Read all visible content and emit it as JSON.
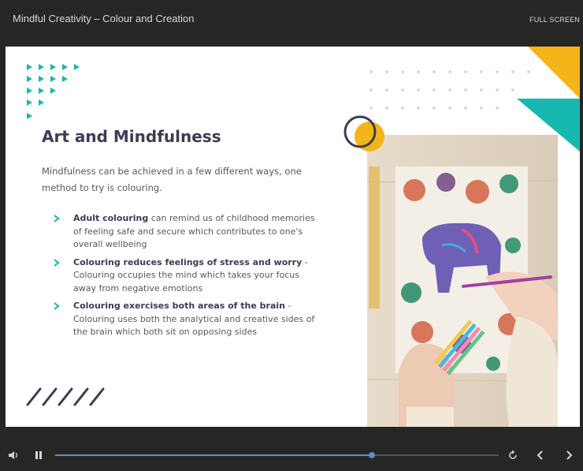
{
  "window": {
    "title": "Mindful Creativity – Colour and Creation",
    "fullscreen_label": "FULL SCREEN"
  },
  "slide": {
    "heading": "Art and Mindfulness",
    "intro": "Mindfulness can be achieved in a few different ways, one method to try is colouring.",
    "bullets": [
      {
        "bold": "Adult colouring",
        "text": " can remind us of childhood memories of feeling safe and secure which contributes to one's overall wellbeing"
      },
      {
        "bold": "Colouring reduces feelings of stress and worry",
        "text": " - Colouring occupies the mind which takes your focus away from negative emotions"
      },
      {
        "bold": "Colouring exercises both areas of the brain",
        "text": " - Colouring uses both the analytical and creative sides of the brain which both sit on opposing sides"
      }
    ],
    "colors": {
      "teal": "#16b8b0",
      "yellow": "#f5b518",
      "navy": "#3a3d55"
    },
    "image_icon": "colouring-book-photo"
  },
  "player": {
    "progress": 0.714,
    "icons": [
      "volume-icon",
      "pause-icon",
      "replay-icon",
      "prev-icon",
      "next-icon"
    ]
  }
}
